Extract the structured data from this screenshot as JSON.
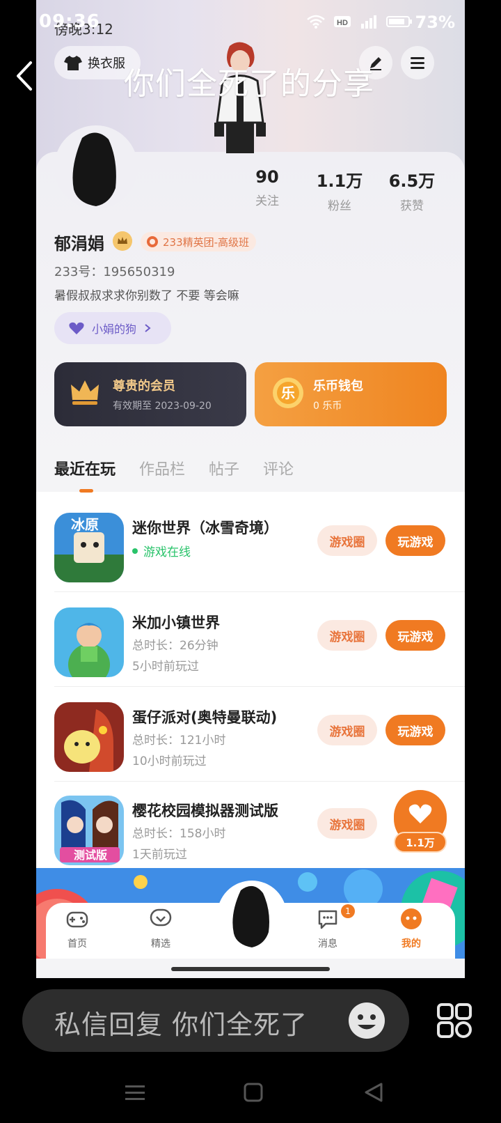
{
  "status_bar": {
    "time": "09:36",
    "inner_time": "傍晚3:12",
    "battery": "73%"
  },
  "overlay": {
    "title": "你们全死了的分享"
  },
  "profile": {
    "wardrobe_label": "换衣服",
    "stats": [
      {
        "value": "90",
        "label": "关注"
      },
      {
        "value": "1.1万",
        "label": "粉丝"
      },
      {
        "value": "6.5万",
        "label": "获赞"
      }
    ],
    "name": "郁涓娟",
    "tag": "233精英团-高级班",
    "uid": "233号：195650319",
    "bio": "暑假叔叔求求你别数了 不要  等会嘛",
    "group_chip": "小娟的狗"
  },
  "cards": {
    "vip": {
      "title": "尊贵的会员",
      "sub": "有效期至 2023-09-20"
    },
    "coin": {
      "title": "乐币钱包",
      "sub": "0 乐币",
      "icon_char": "乐"
    }
  },
  "tabs": [
    "最近在玩",
    "作品栏",
    "帖子",
    "评论"
  ],
  "games": [
    {
      "title": "迷你世界（冰雪奇境）",
      "online": "游戏在线",
      "circle": "游戏圈",
      "play": "玩游戏",
      "icon_text": "冰原",
      "icon_color": "#3b8fd9"
    },
    {
      "title": "米加小镇世界",
      "sub1": "总时长：26分钟",
      "sub2": "5小时前玩过",
      "circle": "游戏圈",
      "play": "玩游戏",
      "icon_color": "#4fb6e8"
    },
    {
      "title": "蛋仔派对(奥特曼联动)",
      "sub1": "总时长：121小时",
      "sub2": "10小时前玩过",
      "circle": "游戏圈",
      "play": "玩游戏",
      "icon_color": "#c0392b"
    },
    {
      "title": "樱花校园模拟器测试版",
      "sub1": "总时长：158小时",
      "sub2": "1天前玩过",
      "circle": "游戏圈",
      "icon_text": "测试版",
      "icon_color": "#7bc4f0"
    }
  ],
  "like": {
    "count": "1.1万"
  },
  "nav": {
    "items": [
      "首页",
      "精选",
      "消息",
      "我的"
    ],
    "badge": "1"
  },
  "reply": {
    "placeholder": "私信回复 你们全死了"
  },
  "colors": {
    "accent": "#f07a22",
    "online": "#29c36a"
  }
}
